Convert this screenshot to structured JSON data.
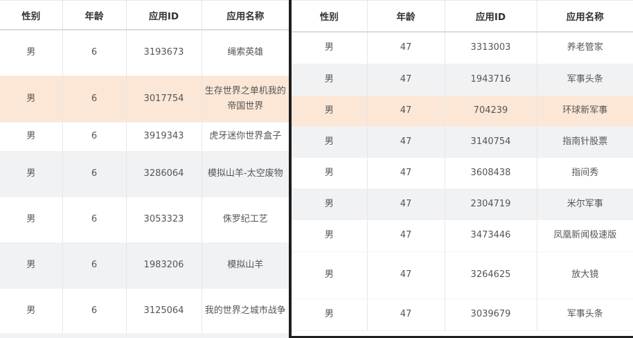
{
  "left_table": {
    "headers": [
      "性别",
      "年龄",
      "应用ID",
      "应用名称"
    ],
    "rows": [
      {
        "gender": "男",
        "age": "6",
        "app_id": "3193673",
        "app_name": "绳索英雄",
        "style": "plain"
      },
      {
        "gender": "男",
        "age": "6",
        "app_id": "3017754",
        "app_name": "生存世界之单机我的帝国世界",
        "style": "highlight"
      },
      {
        "gender": "男",
        "age": "6",
        "app_id": "3919343",
        "app_name": "虎牙迷你世界盒子",
        "style": "plain"
      },
      {
        "gender": "男",
        "age": "6",
        "app_id": "3286064",
        "app_name": "模拟山羊-太空废物",
        "style": "stripe"
      },
      {
        "gender": "男",
        "age": "6",
        "app_id": "3053323",
        "app_name": "侏罗纪工艺",
        "style": "plain"
      },
      {
        "gender": "男",
        "age": "6",
        "app_id": "1983206",
        "app_name": "模拟山羊",
        "style": "stripe"
      },
      {
        "gender": "男",
        "age": "6",
        "app_id": "3125064",
        "app_name": "我的世界之城市战争",
        "style": "plain"
      }
    ]
  },
  "right_table": {
    "headers": [
      "性别",
      "年龄",
      "应用ID",
      "应用名称"
    ],
    "rows": [
      {
        "gender": "男",
        "age": "47",
        "app_id": "3313003",
        "app_name": "养老管家",
        "style": "plain"
      },
      {
        "gender": "男",
        "age": "47",
        "app_id": "1943716",
        "app_name": "军事头条",
        "style": "stripe"
      },
      {
        "gender": "男",
        "age": "47",
        "app_id": "704239",
        "app_name": "环球新军事",
        "style": "highlight"
      },
      {
        "gender": "男",
        "age": "47",
        "app_id": "3140754",
        "app_name": "指南针股票",
        "style": "stripe"
      },
      {
        "gender": "男",
        "age": "47",
        "app_id": "3608438",
        "app_name": "指间秀",
        "style": "plain"
      },
      {
        "gender": "男",
        "age": "47",
        "app_id": "2304719",
        "app_name": "米尔军事",
        "style": "stripe"
      },
      {
        "gender": "男",
        "age": "47",
        "app_id": "3473446",
        "app_name": "凤凰新闻极速版",
        "style": "plain"
      },
      {
        "gender": "男",
        "age": "47",
        "app_id": "3264625",
        "app_name": "放大镜",
        "style": "plain"
      },
      {
        "gender": "男",
        "age": "47",
        "app_id": "3039679",
        "app_name": "军事头条",
        "style": "plain"
      }
    ]
  }
}
